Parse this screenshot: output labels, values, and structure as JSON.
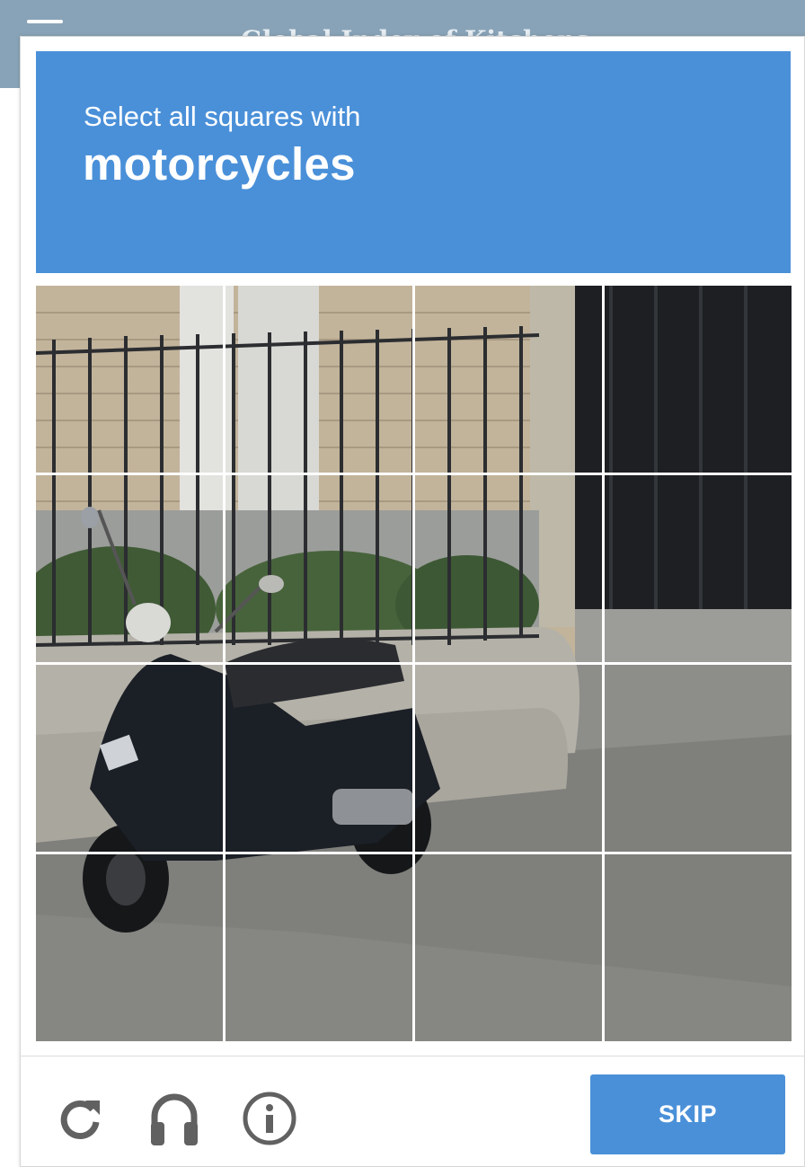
{
  "background_page": {
    "title": "Global Index of Kitchens"
  },
  "challenge": {
    "instruction": "Select all squares with",
    "target": "motorcycles",
    "grid": {
      "rows": 4,
      "cols": 4
    }
  },
  "footer": {
    "icons": [
      "reload-icon",
      "audio-icon",
      "info-icon"
    ],
    "skip_label": "SKIP"
  },
  "colors": {
    "accent": "#4a90d9",
    "bg_header": "#88a3b7",
    "icon_gray": "#616161"
  }
}
